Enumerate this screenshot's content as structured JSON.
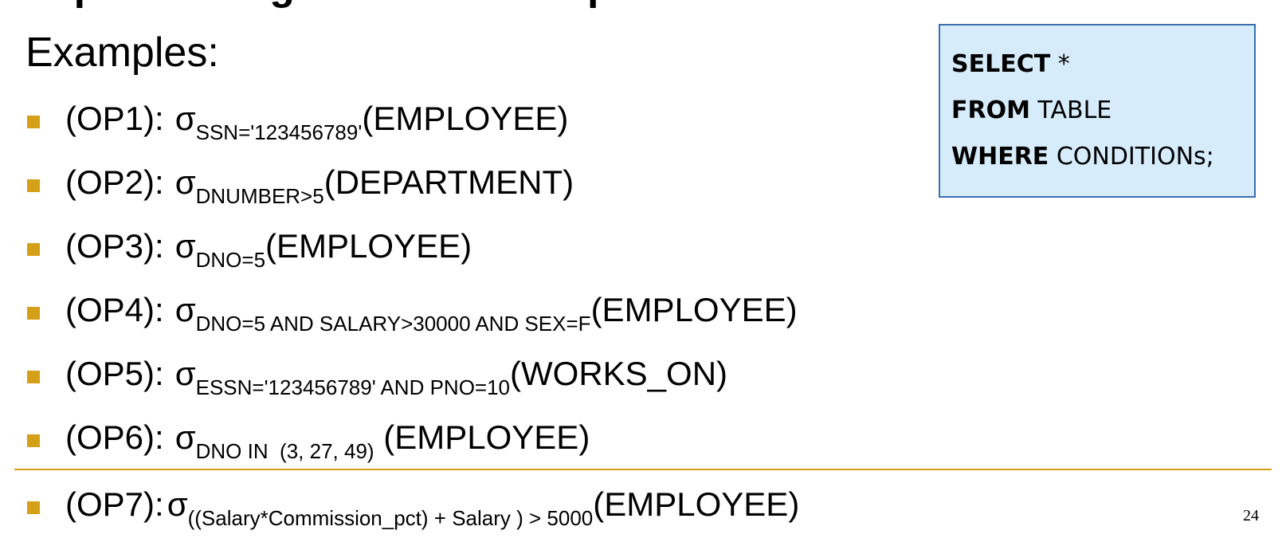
{
  "slide": {
    "clipped_title": "Implementing the SELECT Operation",
    "subheading": "Examples:",
    "page_number": "24",
    "accent_color": "#d4a017"
  },
  "examples": [
    {
      "label": "(OP1):",
      "sigma": "σ",
      "condition": "SSN='123456789'",
      "relation": "(EMPLOYEE)"
    },
    {
      "label": "(OP2):",
      "sigma": "σ",
      "condition": "DNUMBER>5",
      "relation": "(DEPARTMENT)"
    },
    {
      "label": "(OP3):",
      "sigma": "σ",
      "condition": "DNO=5",
      "relation": "(EMPLOYEE)"
    },
    {
      "label": "(OP4):",
      "sigma": "σ",
      "condition": "DNO=5 AND SALARY>30000 AND SEX=F",
      "relation": "(EMPLOYEE)"
    },
    {
      "label": "(OP5):",
      "sigma": "σ",
      "condition": "ESSN='123456789' AND PNO=10",
      "relation": "(WORKS_ON)"
    },
    {
      "label": "(OP6):",
      "sigma": "σ",
      "condition": "DNO IN  (3, 27, 49)",
      "relation": " (EMPLOYEE)"
    },
    {
      "label": "(OP7):",
      "sigma": "σ",
      "condition": "((Salary*Commission_pct) + Salary ) > 5000",
      "relation": "(EMPLOYEE)"
    }
  ],
  "sql_box": {
    "line1_kw": "SELECT",
    "line1_rest": " *",
    "line2_kw": "FROM",
    "line2_rest": " TABLE",
    "line3_kw": "WHERE",
    "line3_rest": " CONDITIONs;",
    "background_color": "#d6ecfb",
    "border_color": "#3a6fb0"
  }
}
